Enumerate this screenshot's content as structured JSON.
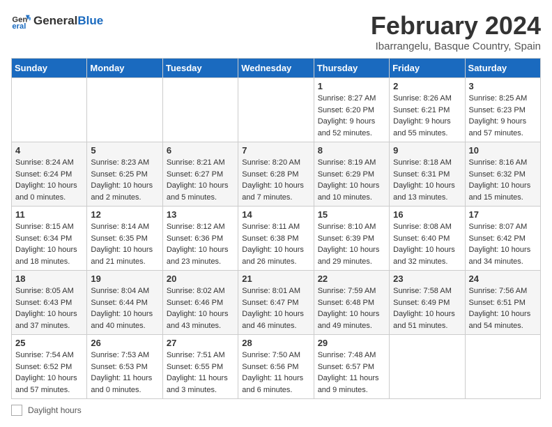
{
  "header": {
    "logo_general": "General",
    "logo_blue": "Blue",
    "title": "February 2024",
    "subtitle": "Ibarrangelu, Basque Country, Spain"
  },
  "columns": [
    "Sunday",
    "Monday",
    "Tuesday",
    "Wednesday",
    "Thursday",
    "Friday",
    "Saturday"
  ],
  "weeks": [
    [
      {
        "day": "",
        "info": ""
      },
      {
        "day": "",
        "info": ""
      },
      {
        "day": "",
        "info": ""
      },
      {
        "day": "",
        "info": ""
      },
      {
        "day": "1",
        "info": "Sunrise: 8:27 AM\nSunset: 6:20 PM\nDaylight: 9 hours\nand 52 minutes."
      },
      {
        "day": "2",
        "info": "Sunrise: 8:26 AM\nSunset: 6:21 PM\nDaylight: 9 hours\nand 55 minutes."
      },
      {
        "day": "3",
        "info": "Sunrise: 8:25 AM\nSunset: 6:23 PM\nDaylight: 9 hours\nand 57 minutes."
      }
    ],
    [
      {
        "day": "4",
        "info": "Sunrise: 8:24 AM\nSunset: 6:24 PM\nDaylight: 10 hours\nand 0 minutes."
      },
      {
        "day": "5",
        "info": "Sunrise: 8:23 AM\nSunset: 6:25 PM\nDaylight: 10 hours\nand 2 minutes."
      },
      {
        "day": "6",
        "info": "Sunrise: 8:21 AM\nSunset: 6:27 PM\nDaylight: 10 hours\nand 5 minutes."
      },
      {
        "day": "7",
        "info": "Sunrise: 8:20 AM\nSunset: 6:28 PM\nDaylight: 10 hours\nand 7 minutes."
      },
      {
        "day": "8",
        "info": "Sunrise: 8:19 AM\nSunset: 6:29 PM\nDaylight: 10 hours\nand 10 minutes."
      },
      {
        "day": "9",
        "info": "Sunrise: 8:18 AM\nSunset: 6:31 PM\nDaylight: 10 hours\nand 13 minutes."
      },
      {
        "day": "10",
        "info": "Sunrise: 8:16 AM\nSunset: 6:32 PM\nDaylight: 10 hours\nand 15 minutes."
      }
    ],
    [
      {
        "day": "11",
        "info": "Sunrise: 8:15 AM\nSunset: 6:34 PM\nDaylight: 10 hours\nand 18 minutes."
      },
      {
        "day": "12",
        "info": "Sunrise: 8:14 AM\nSunset: 6:35 PM\nDaylight: 10 hours\nand 21 minutes."
      },
      {
        "day": "13",
        "info": "Sunrise: 8:12 AM\nSunset: 6:36 PM\nDaylight: 10 hours\nand 23 minutes."
      },
      {
        "day": "14",
        "info": "Sunrise: 8:11 AM\nSunset: 6:38 PM\nDaylight: 10 hours\nand 26 minutes."
      },
      {
        "day": "15",
        "info": "Sunrise: 8:10 AM\nSunset: 6:39 PM\nDaylight: 10 hours\nand 29 minutes."
      },
      {
        "day": "16",
        "info": "Sunrise: 8:08 AM\nSunset: 6:40 PM\nDaylight: 10 hours\nand 32 minutes."
      },
      {
        "day": "17",
        "info": "Sunrise: 8:07 AM\nSunset: 6:42 PM\nDaylight: 10 hours\nand 34 minutes."
      }
    ],
    [
      {
        "day": "18",
        "info": "Sunrise: 8:05 AM\nSunset: 6:43 PM\nDaylight: 10 hours\nand 37 minutes."
      },
      {
        "day": "19",
        "info": "Sunrise: 8:04 AM\nSunset: 6:44 PM\nDaylight: 10 hours\nand 40 minutes."
      },
      {
        "day": "20",
        "info": "Sunrise: 8:02 AM\nSunset: 6:46 PM\nDaylight: 10 hours\nand 43 minutes."
      },
      {
        "day": "21",
        "info": "Sunrise: 8:01 AM\nSunset: 6:47 PM\nDaylight: 10 hours\nand 46 minutes."
      },
      {
        "day": "22",
        "info": "Sunrise: 7:59 AM\nSunset: 6:48 PM\nDaylight: 10 hours\nand 49 minutes."
      },
      {
        "day": "23",
        "info": "Sunrise: 7:58 AM\nSunset: 6:49 PM\nDaylight: 10 hours\nand 51 minutes."
      },
      {
        "day": "24",
        "info": "Sunrise: 7:56 AM\nSunset: 6:51 PM\nDaylight: 10 hours\nand 54 minutes."
      }
    ],
    [
      {
        "day": "25",
        "info": "Sunrise: 7:54 AM\nSunset: 6:52 PM\nDaylight: 10 hours\nand 57 minutes."
      },
      {
        "day": "26",
        "info": "Sunrise: 7:53 AM\nSunset: 6:53 PM\nDaylight: 11 hours\nand 0 minutes."
      },
      {
        "day": "27",
        "info": "Sunrise: 7:51 AM\nSunset: 6:55 PM\nDaylight: 11 hours\nand 3 minutes."
      },
      {
        "day": "28",
        "info": "Sunrise: 7:50 AM\nSunset: 6:56 PM\nDaylight: 11 hours\nand 6 minutes."
      },
      {
        "day": "29",
        "info": "Sunrise: 7:48 AM\nSunset: 6:57 PM\nDaylight: 11 hours\nand 9 minutes."
      },
      {
        "day": "",
        "info": ""
      },
      {
        "day": "",
        "info": ""
      }
    ]
  ],
  "footer": {
    "daylight_label": "Daylight hours"
  }
}
